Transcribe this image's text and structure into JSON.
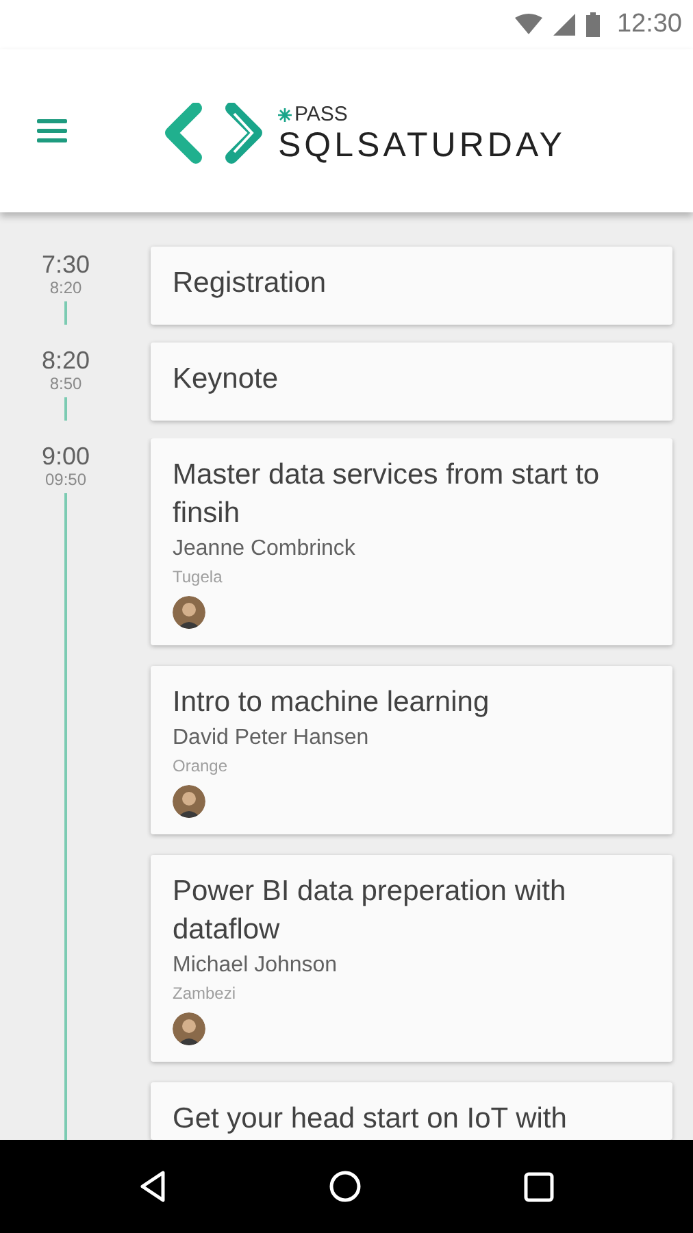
{
  "status_bar": {
    "time": "12:30"
  },
  "app_bar": {
    "logo_top": "PASS",
    "logo_main": "SQLSATURDAY"
  },
  "slots": [
    {
      "start": "7:30",
      "end": "8:20",
      "sessions": [
        {
          "title": "Registration"
        }
      ]
    },
    {
      "start": "8:20",
      "end": "8:50",
      "sessions": [
        {
          "title": "Keynote"
        }
      ]
    },
    {
      "start": "9:00",
      "end": "09:50",
      "sessions": [
        {
          "title": "Master data services from start to finsih",
          "speaker": "Jeanne Combrinck",
          "room": "Tugela"
        },
        {
          "title": "Intro to machine learning",
          "speaker": "David Peter Hansen",
          "room": "Orange"
        },
        {
          "title": "Power BI data preperation with dataflow",
          "speaker": "Michael Johnson",
          "room": "Zambezi"
        },
        {
          "title": "Get your head start on IoT with"
        }
      ]
    }
  ]
}
